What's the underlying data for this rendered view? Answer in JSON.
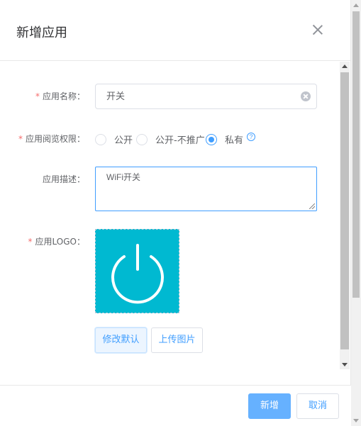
{
  "dialog": {
    "title": "新增应用"
  },
  "form": {
    "name": {
      "label": "应用名称：",
      "value": "开关",
      "required": true
    },
    "permission": {
      "label": "应用阅览权限：",
      "required": true,
      "options": [
        "公开",
        "公开-不推广",
        "私有"
      ],
      "selected": "私有"
    },
    "description": {
      "label": "应用描述：",
      "value": "WiFi开关"
    },
    "logo": {
      "label": "应用LOGO：",
      "required": true,
      "icon": "power-icon",
      "background_color": "#00b9d1"
    },
    "buttons": {
      "modify_default": "修改默认",
      "upload_image": "上传图片"
    }
  },
  "footer": {
    "confirm_label": "新增",
    "cancel_label": "取消"
  },
  "colors": {
    "primary": "#409eff",
    "required": "#f56c6c"
  }
}
